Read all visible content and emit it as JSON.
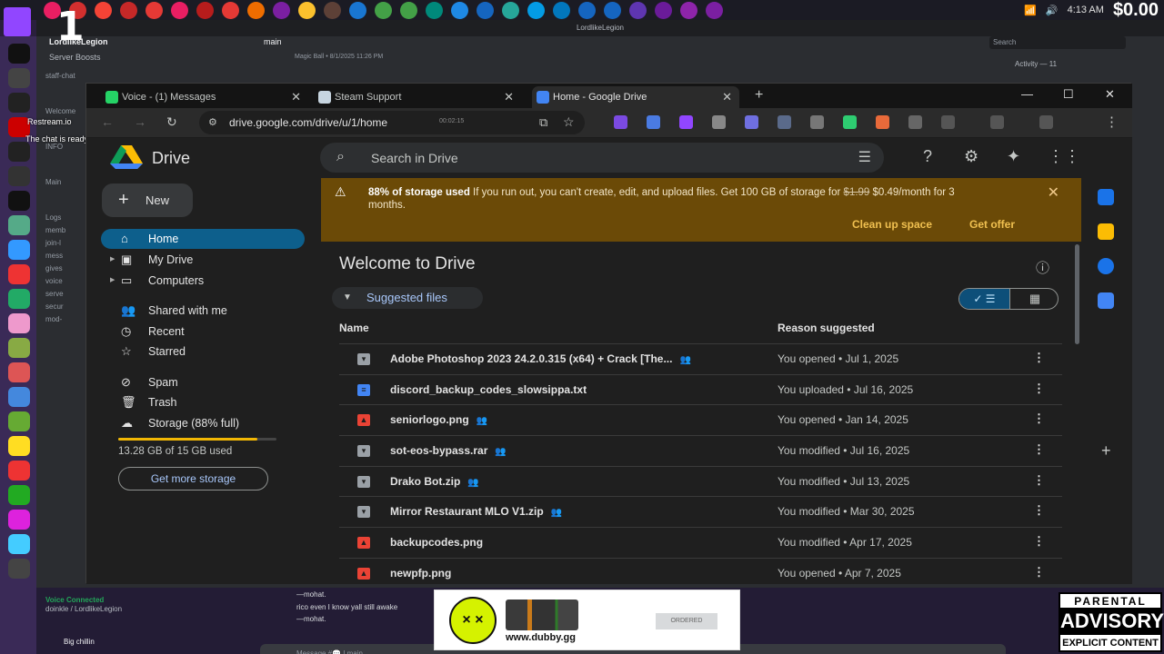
{
  "taskbar": {
    "time": "4:13 AM",
    "money": "$0.00",
    "icon_colors": [
      "#e91e63",
      "#d32f2f",
      "#f44336",
      "#c62828",
      "#e53935",
      "#e91e63",
      "#b71c1c",
      "#e53935",
      "#ef6c00",
      "#7b1fa2",
      "#fbc02d",
      "#5d4037",
      "#1976d2",
      "#43a047",
      "#43a047",
      "#00897b",
      "#1e88e5",
      "#1565c0",
      "#26a69a",
      "#039be5",
      "#0277bd",
      "#1565c0",
      "#1565c0",
      "#5e35b1",
      "#6a1b9a",
      "#8e24aa",
      "#7b1fa2"
    ]
  },
  "stream": {
    "big_number": "1",
    "restream_label": "Restream.io",
    "chat_ready": "The chat is ready to display messages."
  },
  "discord": {
    "header_title": "LordlikeLegion",
    "server_name": "LordlikeLegion",
    "server_boosts": "Server Boosts",
    "channel": "main",
    "search_placeholder": "Search",
    "activity": "Activity — 11",
    "pinned_message": "Magic Ball • 8/1/2025 11:26 PM",
    "channels": [
      "staff-chat",
      "Welcome",
      "INFO",
      "Main",
      "Logs",
      "memb",
      "join-l",
      "mess",
      "gives",
      "voice",
      "serve",
      "secur",
      "mod-"
    ],
    "voice_connected": "Voice Connected",
    "voice_channel": "doinkle / LordlikeLegion",
    "username": "Big chillin",
    "msg1": "—mohat.",
    "msg2": "rico even I know yall still awake",
    "msg3": "—mohat.",
    "message_placeholder": "Message #💬 | main"
  },
  "browser": {
    "tabs": [
      {
        "label": "Voice - (1) Messages",
        "color": "#25d366"
      },
      {
        "label": "Steam Support",
        "color": "#c7d5e0"
      },
      {
        "label": "Home - Google Drive",
        "color": "#4285f4"
      }
    ],
    "url": "drive.google.com/drive/u/1/home",
    "url_timer": "00:02:15"
  },
  "drive": {
    "app_name": "Drive",
    "search_placeholder": "Search in Drive",
    "new_label": "New",
    "nav": {
      "home": "Home",
      "my_drive": "My Drive",
      "computers": "Computers",
      "shared": "Shared with me",
      "recent": "Recent",
      "starred": "Starred",
      "spam": "Spam",
      "trash": "Trash",
      "storage": "Storage (88% full)"
    },
    "storage_fraction": 0.88,
    "storage_used": "13.28 GB of 15 GB used",
    "get_storage": "Get more storage",
    "banner": {
      "headline": "88% of storage used",
      "body": "If you run out, you can't create, edit, and upload files. Get 100 GB of storage for",
      "old_price": "$1.99",
      "new_price": "$0.49/month for 3 months.",
      "cleanup": "Clean up space",
      "offer": "Get offer"
    },
    "welcome": "Welcome to Drive",
    "suggested": "Suggested files",
    "col_name": "Name",
    "col_reason": "Reason suggested",
    "files": [
      {
        "name": "Adobe Photoshop 2023 24.2.0.315 (x64) + Crack [The...",
        "reason": "You opened • Jul 1, 2025",
        "type": "archive",
        "shared": true
      },
      {
        "name": "discord_backup_codes_slowsippa.txt",
        "reason": "You uploaded • Jul 16, 2025",
        "type": "doc",
        "shared": false
      },
      {
        "name": "seniorlogo.png",
        "reason": "You opened • Jan 14, 2025",
        "type": "image",
        "shared": true
      },
      {
        "name": "sot-eos-bypass.rar",
        "reason": "You modified • Jul 16, 2025",
        "type": "archive",
        "shared": true
      },
      {
        "name": "Drako Bot.zip",
        "reason": "You modified • Jul 13, 2025",
        "type": "archive",
        "shared": true
      },
      {
        "name": "Mirror Restaurant MLO V1.zip",
        "reason": "You modified • Mar 30, 2025",
        "type": "archive",
        "shared": true
      },
      {
        "name": "backupcodes.png",
        "reason": "You modified • Apr 17, 2025",
        "type": "image",
        "shared": false
      },
      {
        "name": "newpfp.png",
        "reason": "You opened • Apr 7, 2025",
        "type": "image",
        "shared": false
      }
    ]
  },
  "ad": {
    "url": "www.dubby.gg",
    "button": "ORDERED"
  },
  "advisory": {
    "top": "PARENTAL",
    "mid": "ADVISORY",
    "bottom": "EXPLICIT CONTENT"
  }
}
